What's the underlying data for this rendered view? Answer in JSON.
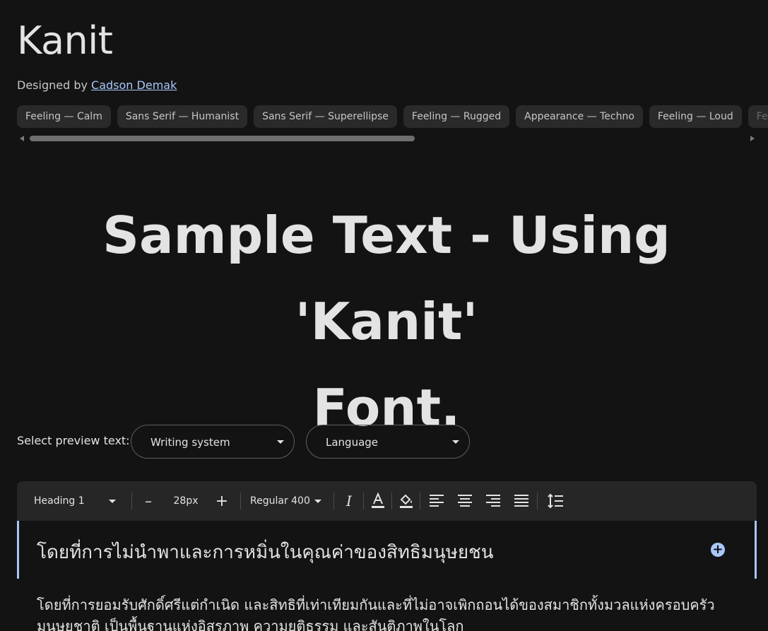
{
  "font": {
    "title": "Kanit",
    "designed_by_prefix": "Designed by",
    "designer": "Cadson Demak"
  },
  "tags": [
    "Feeling — Calm",
    "Sans Serif — Humanist",
    "Sans Serif — Superellipse",
    "Feeling — Rugged",
    "Appearance — Techno",
    "Feeling — Loud",
    "Feel"
  ],
  "sample": {
    "line1": "Sample Text - Using 'Kanit'",
    "line2": "Font."
  },
  "preview": {
    "label": "Select preview text:",
    "writing_system": "Writing system",
    "language": "Language"
  },
  "toolbar": {
    "style": "Heading 1",
    "minus": "–",
    "size": "28px",
    "plus": "+",
    "weight": "Regular 400",
    "italic_glyph": "I",
    "text_color_glyph": "A"
  },
  "editor": {
    "heading": "โดยที่การไม่นำพาและการหมิ่นในคุณค่าของสิทธิมนุษยชน",
    "plus_glyph": "+",
    "paragraph": "โดยที่การยอมรับศักดิ์ศรีแต่กำเนิด และสิทธิที่เท่าเทียมกันและที่ไม่อาจเพิกถอนได้ของสมาชิกทั้งมวลแห่งครอบครัวมนุษยชาติ เป็นพื้นฐานแห่งอิสรภาพ ความยุติธรรม และสันติภาพในโลก"
  },
  "colors": {
    "background": "#131313",
    "accent": "#a8c7fa",
    "chip": "#2a2a2a",
    "toolbar": "#262626"
  },
  "icons": [
    "italic-icon",
    "text-color-icon",
    "fill-color-icon",
    "align-left-icon",
    "align-center-icon",
    "align-right-icon",
    "align-justify-icon",
    "line-height-icon",
    "add-circle-icon"
  ]
}
